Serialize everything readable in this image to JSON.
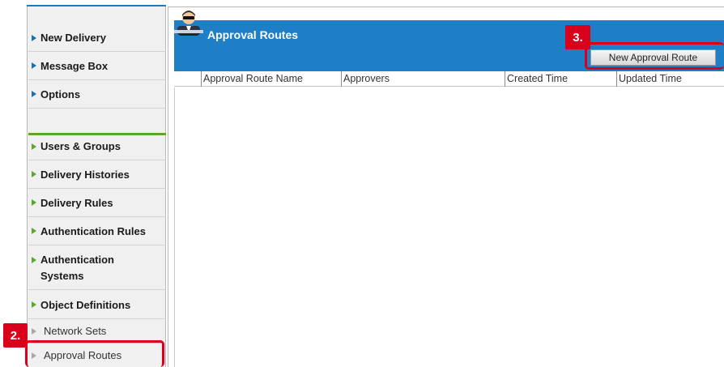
{
  "sidebar": {
    "items": [
      {
        "label": "New Delivery"
      },
      {
        "label": "Message Box"
      },
      {
        "label": "Options"
      },
      {
        "label": "Users & Groups"
      },
      {
        "label": "Delivery Histories"
      },
      {
        "label": "Delivery Rules"
      },
      {
        "label": "Authentication Rules"
      },
      {
        "label": "Authentication Systems"
      },
      {
        "label": "Object Definitions"
      }
    ],
    "sub_items": [
      {
        "label": "Network Sets"
      },
      {
        "label": "Approval Routes"
      }
    ]
  },
  "header": {
    "title": "Approval Routes",
    "new_button_label": "New Approval Route"
  },
  "table": {
    "columns": [
      "Approval Route Name",
      "Approvers",
      "Created Time",
      "Updated Time"
    ]
  },
  "callouts": {
    "step2": "2.",
    "step3": "3."
  },
  "colors": {
    "accent_blue": "#1e7fc6",
    "accent_green": "#58a82a",
    "callout_red": "#d9001b"
  },
  "icons": {
    "header": "agent-icon",
    "nav_arrow": "triangle-right-icon"
  }
}
